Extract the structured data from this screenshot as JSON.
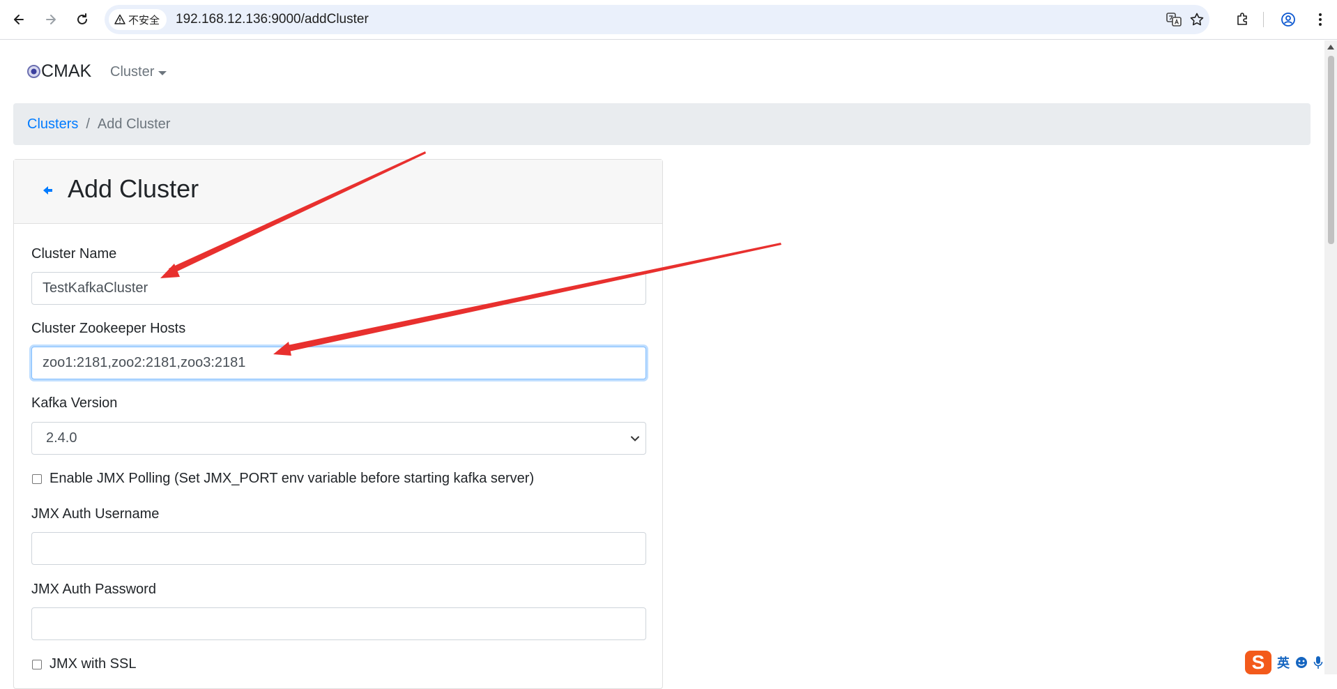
{
  "browser": {
    "security_label": "不安全",
    "url": "192.168.12.136:9000/addCluster"
  },
  "navbar": {
    "brand": "CMAK",
    "cluster_menu": "Cluster"
  },
  "breadcrumb": {
    "link": "Clusters",
    "separator": "/",
    "active": "Add Cluster"
  },
  "form": {
    "title": "Add Cluster",
    "cluster_name_label": "Cluster Name",
    "cluster_name_value": "TestKafkaCluster",
    "zk_hosts_label": "Cluster Zookeeper Hosts",
    "zk_hosts_value": "zoo1:2181,zoo2:2181,zoo3:2181",
    "kafka_version_label": "Kafka Version",
    "kafka_version_value": "2.4.0",
    "jmx_polling_label": "Enable JMX Polling (Set JMX_PORT env variable before starting kafka server)",
    "jmx_username_label": "JMX Auth Username",
    "jmx_username_value": "",
    "jmx_password_label": "JMX Auth Password",
    "jmx_password_value": "",
    "jmx_ssl_label": "JMX with SSL"
  },
  "ime": {
    "logo": "S",
    "mode": "英"
  },
  "colors": {
    "link": "#007bff",
    "annotation_arrow": "#e8302e",
    "focus_border": "#80bdff"
  }
}
